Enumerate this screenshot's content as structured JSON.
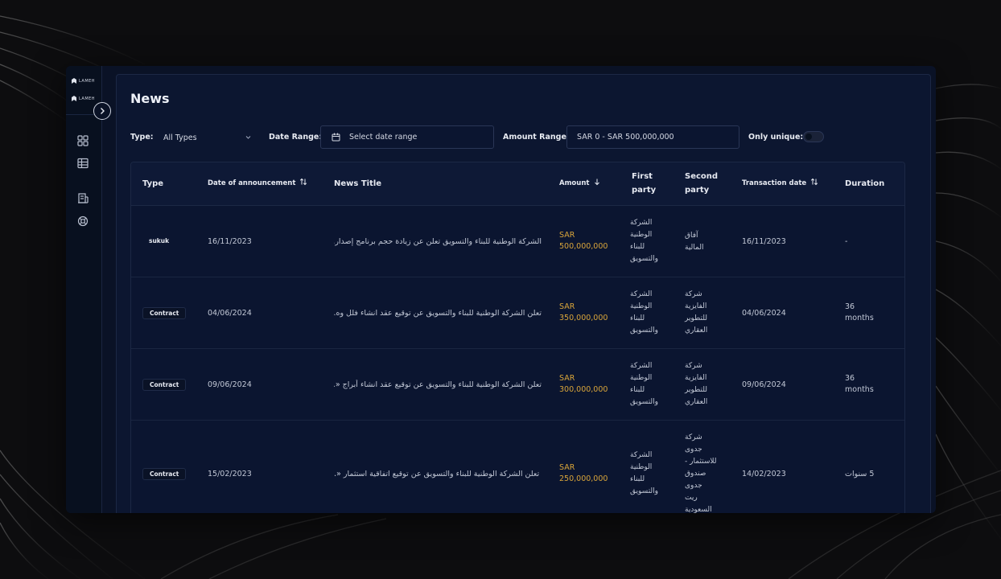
{
  "brand": {
    "name": "LAMEH"
  },
  "page": {
    "title": "News"
  },
  "filters": {
    "type_label": "Type:",
    "type_value": "All Types",
    "date_label": "Date Range:",
    "date_placeholder": "Select date range",
    "amount_label": "Amount Range:",
    "amount_value": "SAR 0 - SAR 500,000,000",
    "unique_label": "Only unique:",
    "unique_on": false
  },
  "table": {
    "columns": {
      "type": "Type",
      "date": "Date of announcement",
      "title": "News Title",
      "amount": "Amount",
      "first_party": "First party",
      "second_party": "Second party",
      "transaction_date": "Transaction date",
      "duration": "Duration"
    },
    "rows": [
      {
        "type": "sukuk",
        "date": "16/11/2023",
        "title": "الشركة الوطنية للبناء والتسويق تعلن عن زيادة حجم برنامج إصدار.",
        "amount_currency": "SAR",
        "amount": "500,000,000",
        "first_party": "الشركة الوطنية للبناء والتسويق",
        "second_party": "آفاق المالية",
        "transaction_date": "16/11/2023",
        "duration": "-"
      },
      {
        "type": "Contract",
        "date": "04/06/2024",
        "title": "تعلن الشركة الوطنية للبناء والتسويق عن توقيع عقد انشاء فلل وه.",
        "amount_currency": "SAR",
        "amount": "350,000,000",
        "first_party": "الشركة الوطنية للبناء والتسويق",
        "second_party": "شركة الفايزية للتطوير العقاري",
        "transaction_date": "04/06/2024",
        "duration": "36 months"
      },
      {
        "type": "Contract",
        "date": "09/06/2024",
        "title": "تعلن الشركة الوطنية للبناء والتسويق عن توقيع عقد انشاء أبراج «.",
        "amount_currency": "SAR",
        "amount": "300,000,000",
        "first_party": "الشركة الوطنية للبناء والتسويق",
        "second_party": "شركة الفايزية للتطوير العقاري",
        "transaction_date": "09/06/2024",
        "duration": "36 months"
      },
      {
        "type": "Contract",
        "date": "15/02/2023",
        "title": "تعلن الشركة الوطنية للبناء والتسويق عن توقيع اتفاقية استثمار «.",
        "amount_currency": "SAR",
        "amount": "250,000,000",
        "first_party": "الشركة الوطنية للبناء والتسويق",
        "second_party": "شركة جدوى للاستثمار - صندوق جدوى ريت السعودية",
        "transaction_date": "14/02/2023",
        "duration": "5 سنوات"
      }
    ]
  },
  "colors": {
    "background": "#0a1226",
    "amount": "#d9a53a"
  },
  "icons": {
    "sidebar": [
      "dashboard-icon",
      "table-icon",
      "building-icon",
      "support-icon"
    ],
    "collapse": "chevron-right-icon"
  }
}
